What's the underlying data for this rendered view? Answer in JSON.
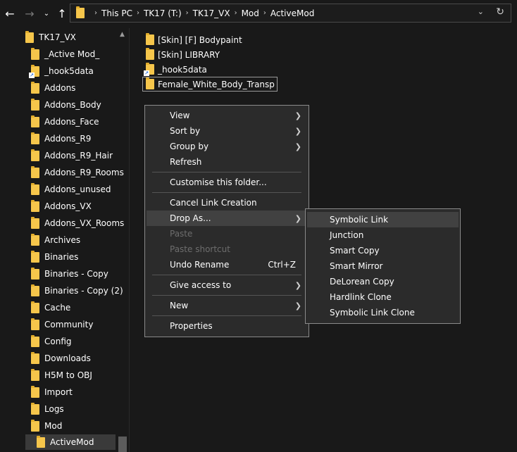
{
  "nav": {
    "back_icon": "arrow-left-icon",
    "forward_icon": "arrow-right-icon",
    "recent_icon": "chevron-down-icon",
    "up_icon": "arrow-up-icon"
  },
  "address": {
    "crumbs": [
      "This PC",
      "TK17 (T:)",
      "TK17_VX",
      "Mod",
      "ActiveMod"
    ],
    "refresh_icon": "refresh-icon"
  },
  "sidebar": {
    "root": "TK17_VX",
    "items": [
      "_Active Mod_",
      "_hook5data",
      "Addons",
      "Addons_Body",
      "Addons_Face",
      "Addons_R9",
      "Addons_R9_Hair",
      "Addons_R9_Rooms",
      "Addons_unused",
      "Addons_VX",
      "Addons_VX_Rooms",
      "Archives",
      "Binaries",
      "Binaries - Copy",
      "Binaries - Copy (2)",
      "Cache",
      "Community",
      "Config",
      "Downloads",
      "H5M to OBJ",
      "Import",
      "Logs",
      "Mod"
    ],
    "selected": "ActiveMod"
  },
  "files": [
    "[Skin] [F] Bodypaint",
    "[Skin] LIBRARY",
    "_hook5data",
    "Female_White_Body_Transp"
  ],
  "context_menu": {
    "items": {
      "view": "View",
      "sort_by": "Sort by",
      "group_by": "Group by",
      "refresh": "Refresh",
      "customise": "Customise this folder...",
      "cancel_link": "Cancel Link Creation",
      "drop_as": "Drop As...",
      "paste": "Paste",
      "paste_shortcut": "Paste shortcut",
      "undo_rename": "Undo Rename",
      "undo_shortcut": "Ctrl+Z",
      "give_access": "Give access to",
      "new": "New",
      "properties": "Properties"
    }
  },
  "submenu": {
    "items": [
      "Symbolic Link",
      "Junction",
      "Smart Copy",
      "Smart Mirror",
      "DeLorean Copy",
      "Hardlink Clone",
      "Symbolic Link Clone"
    ]
  },
  "colors": {
    "background": "#191919",
    "menu_background": "#2b2b2b",
    "hover": "#414141",
    "folder": "#f6c64b"
  }
}
